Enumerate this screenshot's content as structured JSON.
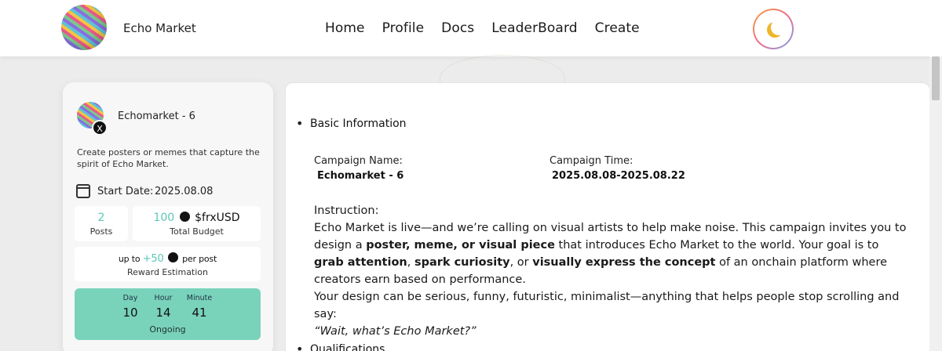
{
  "header": {
    "brand": "Echo Market",
    "nav": [
      "Home",
      "Profile",
      "Docs",
      "LeaderBoard",
      "Create"
    ]
  },
  "card": {
    "title": "Echomarket - 6",
    "x_badge": "X",
    "description": "Create posters or memes that capture the spirit of Echo Market.",
    "start_label": "Start Date:",
    "start_value": "2025.08.08",
    "posts_value": "2",
    "posts_label": "Posts",
    "budget_value": "100",
    "budget_token": "$frxUSD",
    "budget_label": "Total Budget",
    "reward_prefix": "up to",
    "reward_amount": "+50",
    "reward_suffix": "per post",
    "reward_label": "Reward Estimation",
    "timer": {
      "day_label": "Day",
      "day_value": "10",
      "hour_label": "Hour",
      "hour_value": "14",
      "minute_label": "Minute",
      "minute_value": "41",
      "status": "Ongoing"
    }
  },
  "panel": {
    "section1": "Basic Information",
    "campaign_name_label": "Campaign Name:",
    "campaign_name_value": "Echomarket - 6",
    "campaign_time_label": "Campaign Time:",
    "campaign_time_value": "2025.08.08-2025.08.22",
    "instruction_label": "Instruction:",
    "instr_1": "Echo Market is live—and we’re calling on visual artists to help make noise. This campaign invites you to design a ",
    "instr_b1": "poster, meme, or visual piece",
    "instr_2": " that introduces Echo Market to the world. Your goal is to ",
    "instr_b2": "grab attention",
    "instr_3": ", ",
    "instr_b3": "spark curiosity",
    "instr_4": ", or ",
    "instr_b4": "visually express the concept",
    "instr_5": " of an onchain platform where creators earn based on performance.",
    "instr_6": "Your design can be serious, funny, futuristic, minimalist—anything that helps people stop scrolling and say:",
    "instr_quote": "“Wait, what’s Echo Market?”",
    "section2": "Qualifications"
  },
  "colors": {
    "accent": "#5cc6b8",
    "timer_bg": "#79d3bb",
    "moon": "#f0b429"
  },
  "icons": [
    "logo",
    "x-icon",
    "calendar-icon",
    "usd-coin-icon",
    "moon-icon"
  ]
}
